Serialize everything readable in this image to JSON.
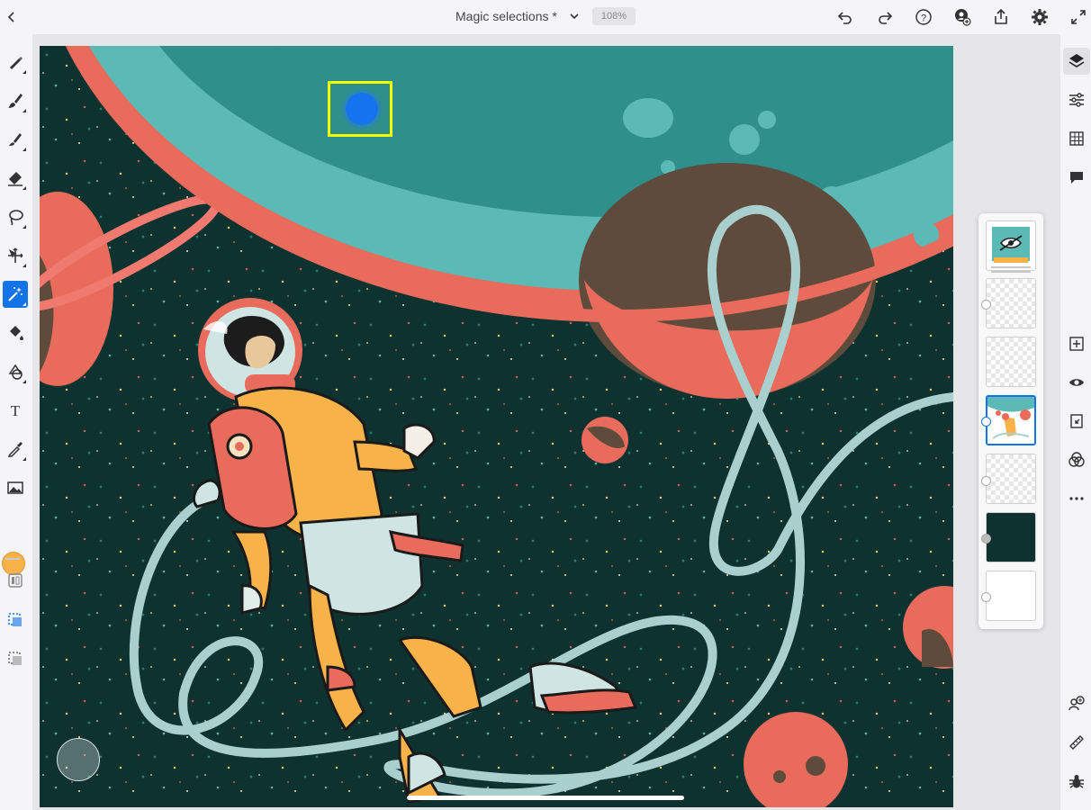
{
  "app": {
    "doc_title": "Magic selections *",
    "zoom": "108%"
  },
  "top_icons": [
    "back-icon",
    "chevron-down-icon",
    "undo-icon",
    "redo-icon",
    "help-icon",
    "user-icon",
    "share-icon",
    "gear-icon",
    "fullscreen-icon"
  ],
  "left_tools": [
    "brush-icon",
    "brush-paint-icon",
    "smudge-icon",
    "eraser-icon",
    "lasso-icon",
    "move-icon",
    "magic-wand-icon",
    "fill-icon",
    "shape-icon",
    "type-icon",
    "eyedropper-icon",
    "image-icon"
  ],
  "active_tool": "magic-wand-icon",
  "current_color": "#f7b24a",
  "right_tools": [
    "layers-icon",
    "adjustments-icon",
    "grid-icon",
    "comment-icon",
    "add-layer-icon",
    "visibility-icon",
    "import-icon",
    "blend-icon",
    "more-icon",
    "avatar-icon",
    "ruler-icon",
    "bug-icon"
  ],
  "layers": [
    {
      "name": "artwork-group",
      "type": "group",
      "hidden": true
    },
    {
      "name": "transparent-1",
      "type": "empty"
    },
    {
      "name": "transparent-2",
      "type": "empty"
    },
    {
      "name": "astronaut",
      "type": "art",
      "selected": true
    },
    {
      "name": "transparent-3",
      "type": "empty"
    },
    {
      "name": "dark-background",
      "type": "fill",
      "color": "#0d3230"
    },
    {
      "name": "white-background",
      "type": "fill",
      "color": "#ffffff"
    }
  ]
}
